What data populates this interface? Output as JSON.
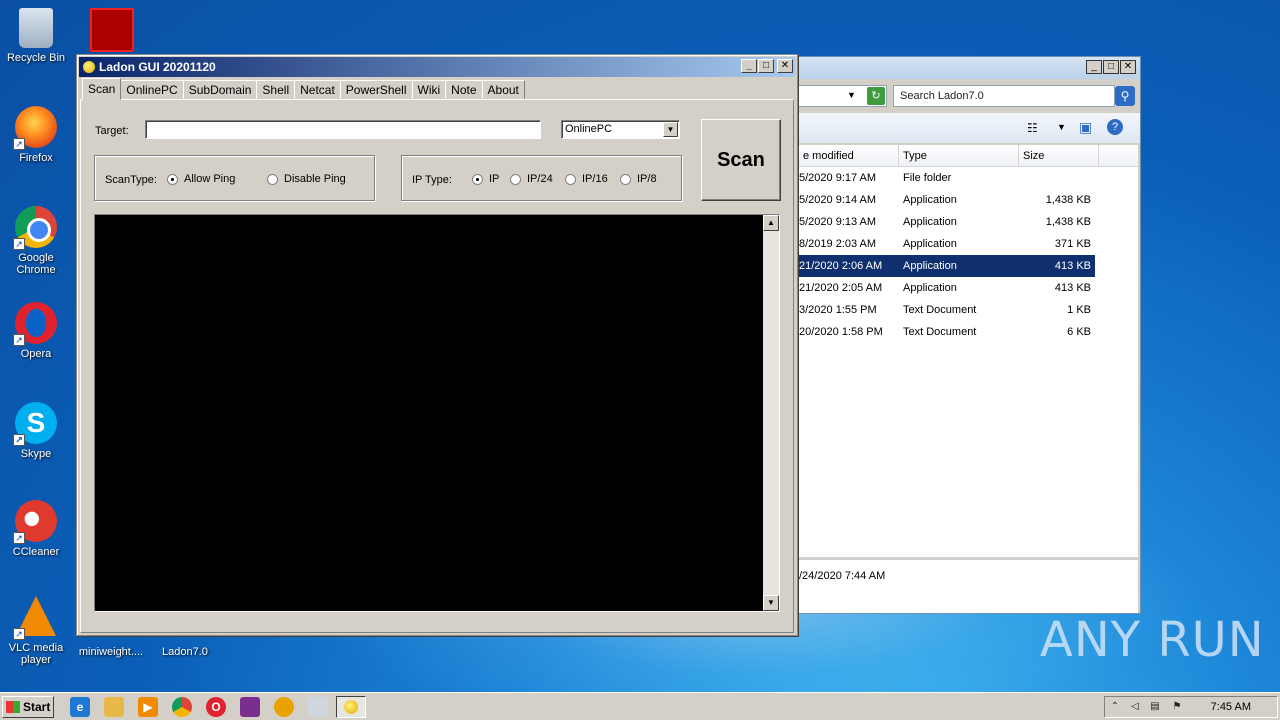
{
  "desktop": {
    "icons": [
      {
        "label": "Recycle Bin"
      },
      {
        "label": "Firefox"
      },
      {
        "label": "Google Chrome"
      },
      {
        "label": "Opera"
      },
      {
        "label": "Skype"
      },
      {
        "label": "CCleaner"
      },
      {
        "label": "VLC media player"
      }
    ],
    "bottom_items": [
      {
        "label": "miniweight...."
      },
      {
        "label": "Ladon7.0"
      }
    ],
    "watermark": "ANY RUN"
  },
  "ladon": {
    "title": "Ladon GUI 20201120",
    "tabs": [
      "Scan",
      "OnlinePC",
      "SubDomain",
      "Shell",
      "Netcat",
      "PowerShell",
      "Wiki",
      "Note",
      "About"
    ],
    "active_tab": "Scan",
    "target_label": "Target:",
    "target_value": "",
    "module_selected": "OnlinePC",
    "scan_type_label": "ScanType:",
    "allow_ping": "Allow Ping",
    "disable_ping": "Disable Ping",
    "ip_type_label": "IP Type:",
    "ip_options": [
      "IP",
      "IP/24",
      "IP/16",
      "IP/8"
    ],
    "scan_button": "Scan",
    "output": ""
  },
  "explorer": {
    "search_placeholder": "Search Ladon7.0",
    "columns": [
      "e modified",
      "Type",
      "Size"
    ],
    "rows": [
      {
        "date": "5/2020 9:17 AM",
        "type": "File folder",
        "size": ""
      },
      {
        "date": "5/2020 9:14 AM",
        "type": "Application",
        "size": "1,438 KB"
      },
      {
        "date": "5/2020 9:13 AM",
        "type": "Application",
        "size": "1,438 KB"
      },
      {
        "date": "8/2019 2:03 AM",
        "type": "Application",
        "size": "371 KB"
      },
      {
        "date": "21/2020 2:06 AM",
        "type": "Application",
        "size": "413 KB"
      },
      {
        "date": "21/2020 2:05 AM",
        "type": "Application",
        "size": "413 KB"
      },
      {
        "date": "3/2020 1:55 PM",
        "type": "Text Document",
        "size": "1 KB"
      },
      {
        "date": "20/2020 1:58 PM",
        "type": "Text Document",
        "size": "6 KB"
      }
    ],
    "selected_row": 4,
    "details_date": "/24/2020 7:44 AM"
  },
  "taskbar": {
    "start_label": "Start",
    "clock": "7:45 AM"
  }
}
